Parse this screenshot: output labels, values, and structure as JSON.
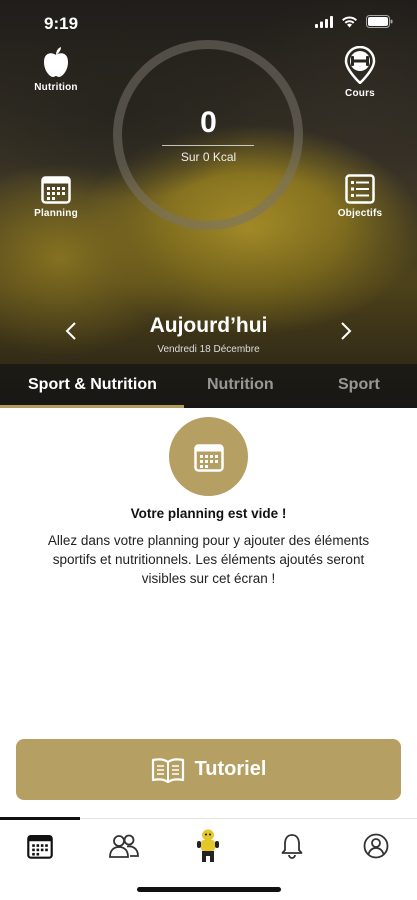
{
  "status_bar": {
    "time": "9:19"
  },
  "header": {
    "nutrition_label": "Nutrition",
    "courses_label": "Cours",
    "planning_label": "Planning",
    "objectives_label": "Objectifs",
    "kcal_value": "0",
    "kcal_subtitle": "Sur 0 Kcal"
  },
  "date_nav": {
    "title": "Aujourd’hui",
    "subtitle": "Vendredi 18 Décembre"
  },
  "tabs": [
    {
      "label": "Sport & Nutrition",
      "active": true
    },
    {
      "label": "Nutrition",
      "active": false
    },
    {
      "label": "Sport",
      "active": false
    }
  ],
  "empty_state": {
    "icon": "calendar-icon",
    "title": "Votre planning est vide !",
    "text": "Allez dans votre planning pour y ajouter des éléments sportifs et nutritionnels. Les éléments ajoutés seront visibles sur cet écran !"
  },
  "tutorial_button": {
    "label": "Tutoriel",
    "icon": "open-book-icon"
  },
  "bottom_nav": [
    {
      "name": "calendar-icon",
      "active": true
    },
    {
      "name": "community-icon",
      "active": false
    },
    {
      "name": "coach-mascot-icon",
      "active": false
    },
    {
      "name": "bell-icon",
      "active": false
    },
    {
      "name": "profile-icon",
      "active": false
    }
  ],
  "colors": {
    "accent": "#b59f63",
    "tab_underline": "#b39b5c"
  }
}
